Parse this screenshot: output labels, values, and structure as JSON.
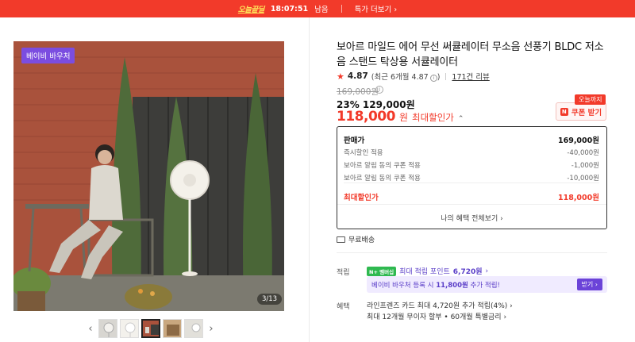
{
  "banner": {
    "deal_label": "오늘끝딜",
    "timer": "18:07:51",
    "remaining": "남음",
    "more_label": "특가 더보기"
  },
  "gallery": {
    "voucher_badge": "베이비 바우처",
    "counter": "3/13",
    "thumbnail_count": 5,
    "active_thumbnail": 3
  },
  "product": {
    "title": "보아르 마일드 에어 무선 써큘레이터 무소음 선풍기 BLDC 저소음 스탠드 탁상용 서큘레이터",
    "rating": "4.87",
    "rating_recent": "(최근 6개월 4.87",
    "rating_recent_close": ")",
    "review_link": "171건 리뷰",
    "original_price": "169,000원",
    "discount_rate": "23%",
    "sale_price": "129,000원",
    "final_price": "118,000",
    "final_unit": "원",
    "final_label": "최대할인가"
  },
  "coupon": {
    "tag": "오늘까지",
    "button_label": "쿠폰 받기"
  },
  "breakdown": {
    "rows": [
      {
        "label": "판매가",
        "value": "169,000원"
      },
      {
        "label": "즉시할인 적용",
        "value": "-40,000원"
      },
      {
        "label": "보아르 알림 동의 쿠폰 적용",
        "value": "-1,000원"
      },
      {
        "label": "보아르 알림 동의 쿠폰 적용",
        "value": "-10,000원"
      }
    ],
    "total_label": "최대할인가",
    "total_value": "118,000원",
    "all_benefits": "나의 혜택 전체보기"
  },
  "shipping": {
    "label": "무료배송"
  },
  "points": {
    "label": "적립",
    "badge": "N+ 멤버십",
    "text": "최대 적립 포인트",
    "amount": "6,720원"
  },
  "voucher": {
    "text_prefix": "베이비 바우처 등록 시",
    "amount": "11,800원",
    "text_suffix": "추가 적립!",
    "button": "받기"
  },
  "benefits": {
    "label": "혜택",
    "line1": "라인프렌즈 카드 최대 4,720원 추가 적립(4%)",
    "line2": "최대 12개월 무이자 할부 • 60개월 특별금리"
  },
  "colors": {
    "accent_red": "#f23a2a",
    "purple": "#6b43d8",
    "naver_green": "#2fb950"
  }
}
